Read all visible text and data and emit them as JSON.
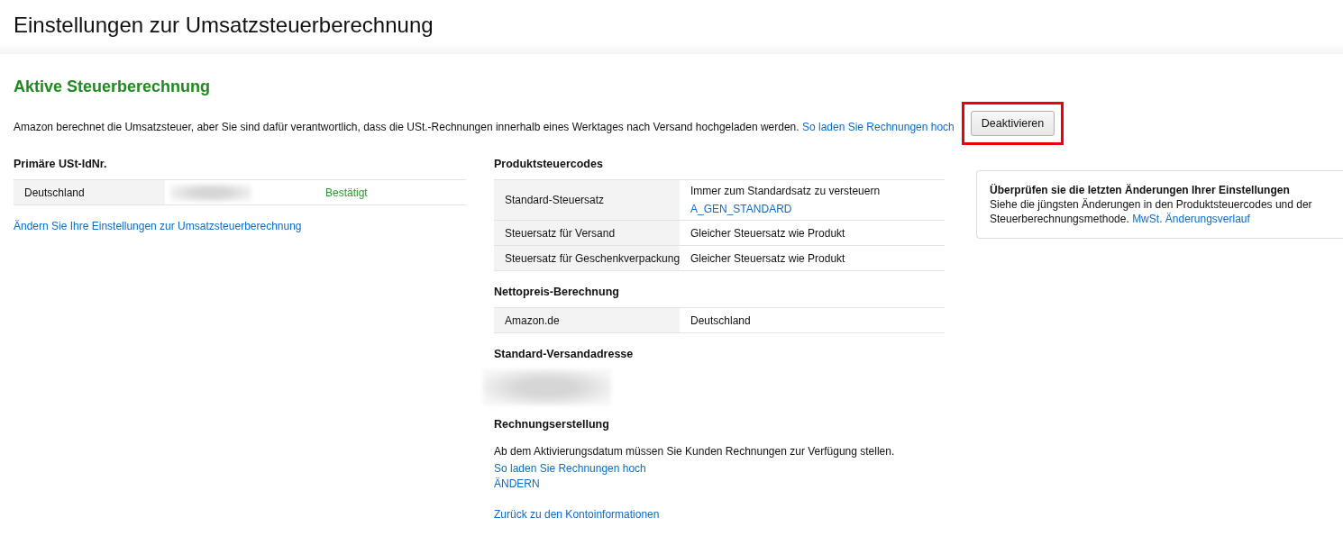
{
  "page_title": "Einstellungen zur Umsatzsteuerberechnung",
  "status_heading": "Aktive Steuerberechnung",
  "notice": {
    "text": "Amazon berechnet die Umsatzsteuer, aber Sie sind dafür verantwortlich, dass die USt.-Rechnungen innerhalb eines Werktages nach Versand hochgeladen werden.",
    "link": "So laden Sie Rechnungen hoch",
    "button": {
      "label": "Deaktivieren",
      "highlighted": true
    }
  },
  "vat_id": {
    "heading": "Primäre USt-IdNr.",
    "rows": [
      {
        "country": "Deutschland",
        "number_redacted": true,
        "status": "Bestätigt"
      }
    ],
    "link": "Ändern Sie Ihre Einstellungen zur Umsatzsteuerberechnung"
  },
  "product_tax_codes": {
    "heading": "Produktsteuercodes",
    "rows": [
      {
        "label": "Standard-Steuersatz",
        "value": "Immer zum Standardsatz zu versteuern",
        "code": "A_GEN_STANDARD"
      },
      {
        "label": "Steuersatz für Versand",
        "value": "Gleicher Steuersatz wie Produkt"
      },
      {
        "label": "Steuersatz für Geschenkverpackung",
        "value": "Gleicher Steuersatz wie Produkt"
      }
    ]
  },
  "net_price": {
    "heading": "Nettopreis-Berechnung",
    "rows": [
      {
        "label": "Amazon.de",
        "value": "Deutschland"
      }
    ]
  },
  "shipping_address": {
    "heading": "Standard-Versandadresse",
    "redacted": true
  },
  "invoicing": {
    "heading": "Rechnungserstellung",
    "text": "Ab dem Aktivierungsdatum müssen Sie Kunden Rechnungen zur Verfügung stellen.",
    "link": "So laden Sie Rechnungen hoch",
    "change_link": "ÄNDERN"
  },
  "back_link": "Zurück zu den Kontoinformationen",
  "review_card": {
    "title": "Überprüfen sie die letzten Änderungen Ihrer Einstellungen",
    "text": "Siehe die jüngsten Änderungen in den Produktsteuercodes und der Steuerberechnungsmethode.",
    "link": "MwSt. Änderungsverlauf"
  }
}
